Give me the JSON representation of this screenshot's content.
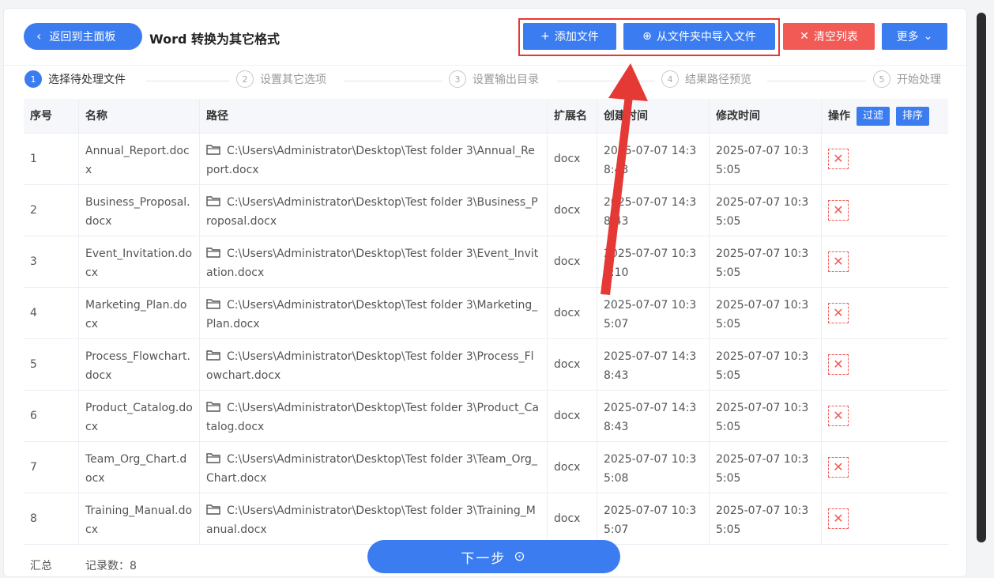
{
  "header": {
    "back_label": "返回到主面板",
    "title": "Word 转换为其它格式"
  },
  "toolbar": {
    "add_file": "添加文件",
    "import_folder": "从文件夹中导入文件",
    "clear_list": "清空列表",
    "more": "更多"
  },
  "steps": [
    {
      "num": "1",
      "label": "选择待处理文件"
    },
    {
      "num": "2",
      "label": "设置其它选项"
    },
    {
      "num": "3",
      "label": "设置输出目录"
    },
    {
      "num": "4",
      "label": "结果路径预览"
    },
    {
      "num": "5",
      "label": "开始处理"
    }
  ],
  "table": {
    "headers": [
      "序号",
      "名称",
      "路径",
      "扩展名",
      "创建时间",
      "修改时间",
      "操作"
    ],
    "filter_label": "过滤",
    "sort_label": "排序",
    "rows": [
      {
        "idx": "1",
        "name": "Annual_Report.docx",
        "path": "C:\\Users\\Administrator\\Desktop\\Test folder 3\\Annual_Report.docx",
        "ext": "docx",
        "created": "2025-07-07 14:38:43",
        "modified": "2025-07-07 10:35:05"
      },
      {
        "idx": "2",
        "name": "Business_Proposal.docx",
        "path": "C:\\Users\\Administrator\\Desktop\\Test folder 3\\Business_Proposal.docx",
        "ext": "docx",
        "created": "2025-07-07 14:38:43",
        "modified": "2025-07-07 10:35:05"
      },
      {
        "idx": "3",
        "name": "Event_Invitation.docx",
        "path": "C:\\Users\\Administrator\\Desktop\\Test folder 3\\Event_Invitation.docx",
        "ext": "docx",
        "created": "2025-07-07 10:35:10",
        "modified": "2025-07-07 10:35:05"
      },
      {
        "idx": "4",
        "name": "Marketing_Plan.docx",
        "path": "C:\\Users\\Administrator\\Desktop\\Test folder 3\\Marketing_Plan.docx",
        "ext": "docx",
        "created": "2025-07-07 10:35:07",
        "modified": "2025-07-07 10:35:05"
      },
      {
        "idx": "5",
        "name": "Process_Flowchart.docx",
        "path": "C:\\Users\\Administrator\\Desktop\\Test folder 3\\Process_Flowchart.docx",
        "ext": "docx",
        "created": "2025-07-07 14:38:43",
        "modified": "2025-07-07 10:35:05"
      },
      {
        "idx": "6",
        "name": "Product_Catalog.docx",
        "path": "C:\\Users\\Administrator\\Desktop\\Test folder 3\\Product_Catalog.docx",
        "ext": "docx",
        "created": "2025-07-07 14:38:43",
        "modified": "2025-07-07 10:35:05"
      },
      {
        "idx": "7",
        "name": "Team_Org_Chart.docx",
        "path": "C:\\Users\\Administrator\\Desktop\\Test folder 3\\Team_Org_Chart.docx",
        "ext": "docx",
        "created": "2025-07-07 10:35:08",
        "modified": "2025-07-07 10:35:05"
      },
      {
        "idx": "8",
        "name": "Training_Manual.docx",
        "path": "C:\\Users\\Administrator\\Desktop\\Test folder 3\\Training_Manual.docx",
        "ext": "docx",
        "created": "2025-07-07 10:35:07",
        "modified": "2025-07-07 10:35:05"
      }
    ]
  },
  "summary": {
    "label": "汇总",
    "count_text": "记录数：8"
  },
  "next_button": "下一步",
  "colors": {
    "primary": "#3b7cf0",
    "danger": "#f25a55",
    "annotation": "#e53935"
  }
}
